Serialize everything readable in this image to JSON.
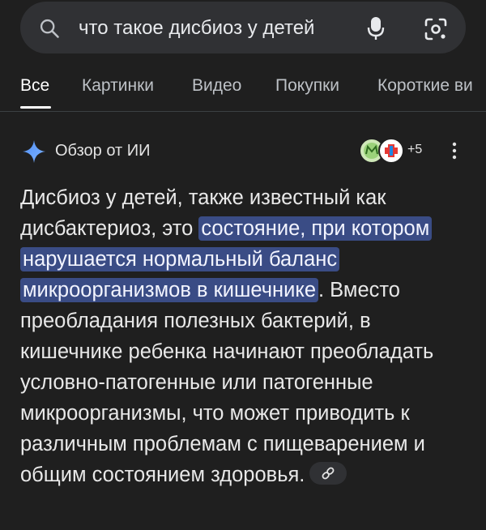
{
  "search": {
    "query": "что такое дисбиоз у детей"
  },
  "tabs": [
    {
      "label": "Все",
      "active": true
    },
    {
      "label": "Картинки",
      "active": false
    },
    {
      "label": "Видео",
      "active": false
    },
    {
      "label": "Покупки",
      "active": false
    },
    {
      "label": "Короткие ви",
      "active": false
    }
  ],
  "ai_overview": {
    "title": "Обзор от ИИ",
    "sources_more": "+5",
    "answer_intro": "Дисбиоз у детей, также известный как дисбактериоз, это ",
    "answer_highlight": "состояние, при котором нарушается нормальный баланс микроорганизмов в кишечнике",
    "answer_rest": ". Вместо преобладания полезных бактерий, в кишечнике ребенка начинают преобладать условно-патогенные или патогенные микроорганизмы, что может приводить к различным проблемам с пищеварением и общим состоянием здоровья."
  },
  "colors": {
    "background": "#1f1f1f",
    "search_bar": "#303134",
    "highlight": "#3a4c85",
    "gemini_blue": "#4f8ff7"
  }
}
